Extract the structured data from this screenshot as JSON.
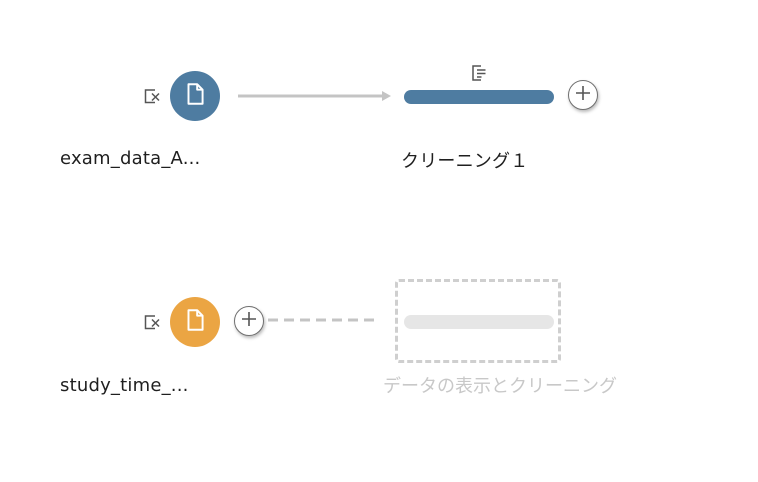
{
  "flow": {
    "inputs": [
      {
        "name": "exam_data_A...",
        "icon": "document-icon",
        "color": "#4e7ca1",
        "remove_icon": "remove-input-icon"
      },
      {
        "name": "study_time_...",
        "icon": "document-icon",
        "color": "#eba543",
        "remove_icon": "remove-input-icon"
      }
    ],
    "cleaning_step": {
      "label": "クリーニング１",
      "icon": "clean-step-icon",
      "color": "#4e7ca1"
    },
    "add_step_icon": "plus-icon",
    "placeholder_step": {
      "label": "データの表示とクリーニング"
    },
    "connector_color": "#c4c4c4"
  }
}
